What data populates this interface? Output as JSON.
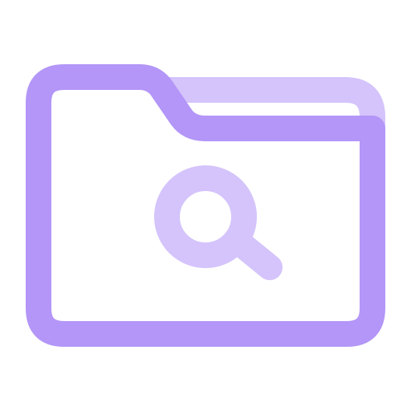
{
  "icon": {
    "name": "folder-search-icon",
    "colors": {
      "primary": "#B396F7",
      "secondary": "#D4C4FB"
    }
  }
}
